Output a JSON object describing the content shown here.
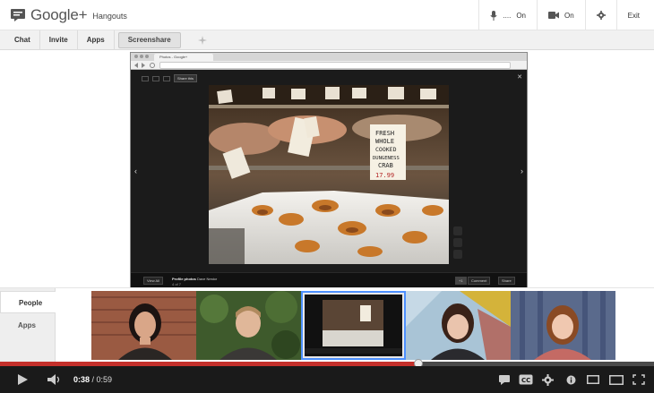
{
  "app": {
    "google_label": "Google+",
    "product_label": "Hangouts"
  },
  "top_controls": {
    "mic": {
      "label": "....",
      "value": "On",
      "icon": "microphone-icon"
    },
    "camera": {
      "value": "On",
      "icon": "camera-icon"
    },
    "settings_icon": "gear-icon",
    "exit_label": "Exit"
  },
  "toolbar": {
    "chat_label": "Chat",
    "invite_label": "Invite",
    "apps_label": "Apps",
    "screenshare_label": "Screenshare",
    "extra_icon": "effects-icon"
  },
  "shared_screen": {
    "browser_tab_label": "Photos - Google+",
    "viewer_share_label": "Share this",
    "album_title": "Profile photos",
    "album_owner": "Dave Nestor",
    "album_sub": "4 of 7",
    "view_all_label": "View All",
    "comment_label": "Comment",
    "share_label": "Share",
    "plus_one_label": "+1",
    "sign_line_1": "FRESH",
    "sign_line_2": "WHOLE",
    "sign_line_3": "COOKED",
    "sign_line_4": "DUNGENESS",
    "sign_line_5": "CRAB",
    "sign_price": "17.99"
  },
  "people_panel": {
    "people_tab": "People",
    "apps_tab": "Apps",
    "participants": [
      {
        "name": "participant-1"
      },
      {
        "name": "participant-2"
      },
      {
        "name": "participant-3-screenshare"
      },
      {
        "name": "participant-4"
      },
      {
        "name": "participant-5"
      }
    ]
  },
  "player": {
    "current_time": "0:38",
    "separator": " / ",
    "duration": "0:59",
    "progress": 0.64,
    "colors": {
      "progress": "#c4302b",
      "selection": "#4d90fe"
    }
  }
}
